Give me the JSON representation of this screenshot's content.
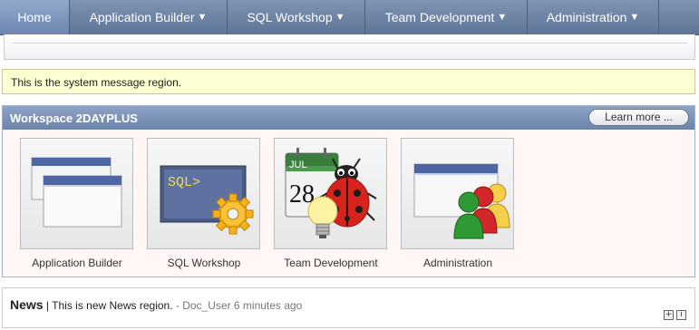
{
  "nav": {
    "tabs": [
      {
        "label": "Home",
        "active": true
      },
      {
        "label": "Application Builder",
        "dropdown": true
      },
      {
        "label": "SQL Workshop",
        "dropdown": true
      },
      {
        "label": "Team Development",
        "dropdown": true
      },
      {
        "label": "Administration",
        "dropdown": true
      }
    ],
    "caret": "▼"
  },
  "system_message": "This is the system message region.",
  "workspace": {
    "title": "Workspace 2DAYPLUS",
    "learn_more": "Learn more ...",
    "tiles": [
      {
        "label": "Application Builder",
        "icon": "application-builder-icon"
      },
      {
        "label": "SQL Workshop",
        "icon": "sql-workshop-icon",
        "icon_text": "SQL>"
      },
      {
        "label": "Team Development",
        "icon": "team-development-icon",
        "calendar_month": "JUL",
        "calendar_day": "28"
      },
      {
        "label": "Administration",
        "icon": "administration-icon"
      }
    ]
  },
  "news": {
    "title": "News",
    "separator": " | ",
    "text": "This is new News region.",
    "meta": " - Doc_User 6 minutes ago",
    "add_button": "+",
    "info_button": "i"
  },
  "colors": {
    "nav": "#5f7597",
    "header": "#7a90b8",
    "message_bg": "#fefed3"
  }
}
